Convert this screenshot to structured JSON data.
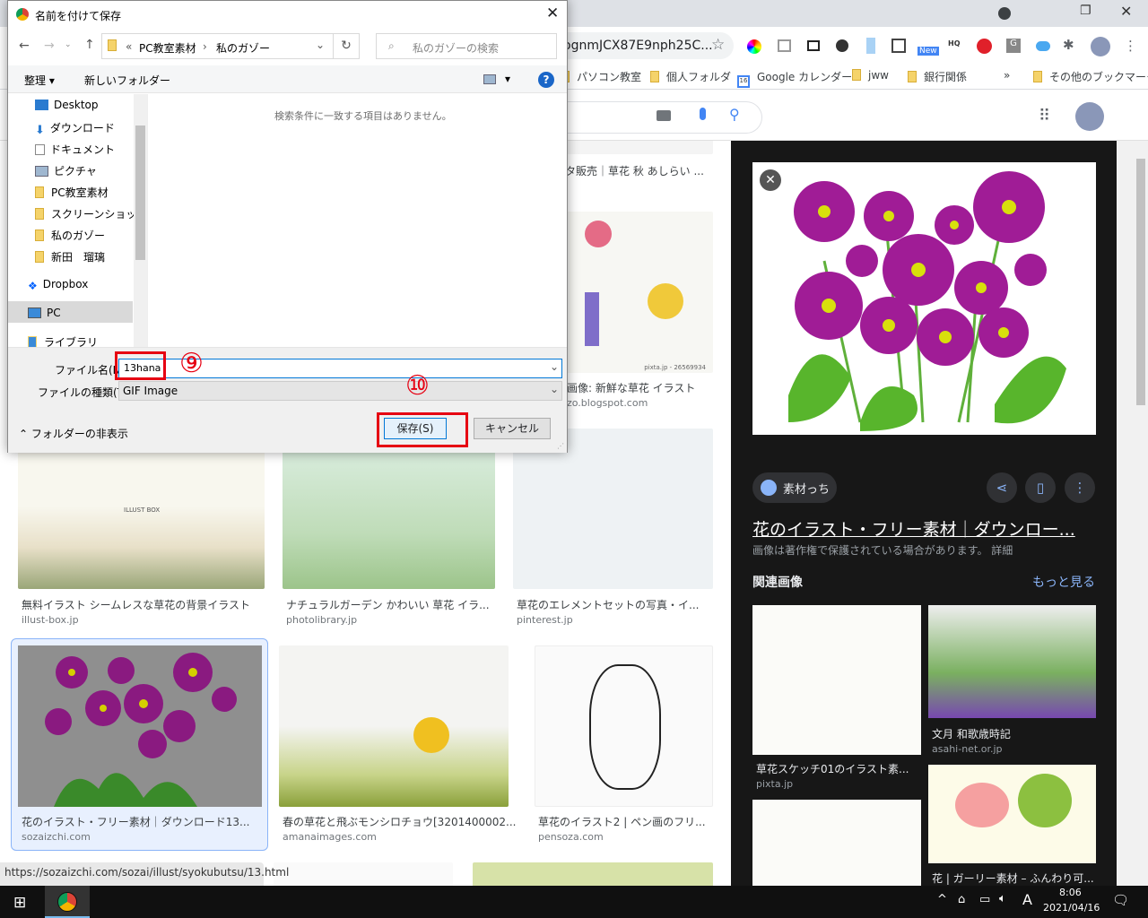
{
  "browser": {
    "omnibox_text": "ognmJCX87E9nph25C...",
    "bookmarks": [
      "パソコン教室",
      "個人フォルダ",
      "Google カレンダー",
      "jww",
      "銀行関係",
      "その他のブックマーク"
    ],
    "calendar_badge": "16",
    "extension_badge": "New",
    "status_url": "https://sozaizchi.com/sozai/illust/syokubutsu/13.html"
  },
  "results": {
    "items": [
      {
        "title": "タ販売｜草花 秋 あしらい ...",
        "domain": ""
      },
      {
        "title": "画像: 新鮮な草花 イラスト",
        "domain": "zo.blogspot.com"
      },
      {
        "title": "無料イラスト シームレスな草花の背景イラスト",
        "domain": "illust-box.jp"
      },
      {
        "title": "ナチュラルガーデン かわいい 草花 イラ...",
        "domain": "photolibrary.jp"
      },
      {
        "title": "草花のエレメントセットの写真・イ...",
        "domain": "pinterest.jp"
      },
      {
        "title": "花のイラスト・フリー素材｜ダウンロード13...",
        "domain": "sozaizchi.com"
      },
      {
        "title": "春の草花と飛ぶモンシロチョウ[3201400002...",
        "domain": "amanaimages.com"
      },
      {
        "title": "草花のイラスト2 | ペン画のフリ...",
        "domain": "pensoza.com"
      }
    ],
    "watermarks": [
      "pixta.jp - 26569934",
      "ILLUST BOX"
    ]
  },
  "panel": {
    "source": "素材っち",
    "title": "花のイラスト・フリー素材｜ダウンロー...",
    "copyright": "画像は著作権で保護されている場合があります。",
    "details_link": "詳細",
    "related_heading": "関連画像",
    "more_link": "もっと見る",
    "related": [
      {
        "title": "草花スケッチ01のイラスト素...",
        "domain": "pixta.jp"
      },
      {
        "title": "文月 和歌歳時記",
        "domain": "asahi-net.or.jp"
      },
      {
        "title": "花 | ガーリー素材 – ふんわり可...",
        "domain": ""
      }
    ]
  },
  "dialog": {
    "title": "名前を付けて保存",
    "breadcrumb": [
      "PC教室素材",
      "私のガゾー"
    ],
    "breadcrumb_prefix": "«",
    "search_placeholder": "私のガゾーの検索",
    "organize": "整理",
    "new_folder": "新しいフォルダー",
    "help": "?",
    "nav_items": [
      "Desktop",
      "ダウンロード",
      "ドキュメント",
      "ピクチャ",
      "PC教室素材",
      "スクリーンショット",
      "私のガゾー",
      "新田　瑠璃",
      "Dropbox",
      "PC",
      "ライブラリ"
    ],
    "empty_message": "検索条件に一致する項目はありません。",
    "filename_label": "ファイル名(N):",
    "filename_value": "13hana",
    "filetype_label": "ファイルの種類(T):",
    "filetype_value": "GIF Image",
    "hide_folders": "フォルダーの非表示",
    "save": "保存(S)",
    "cancel": "キャンセル",
    "annotation_9": "⑨",
    "annotation_10": "⑩",
    "highlight_color": "#e60012"
  },
  "taskbar": {
    "time": "8:06",
    "date": "2021/04/16",
    "ime": "A"
  }
}
